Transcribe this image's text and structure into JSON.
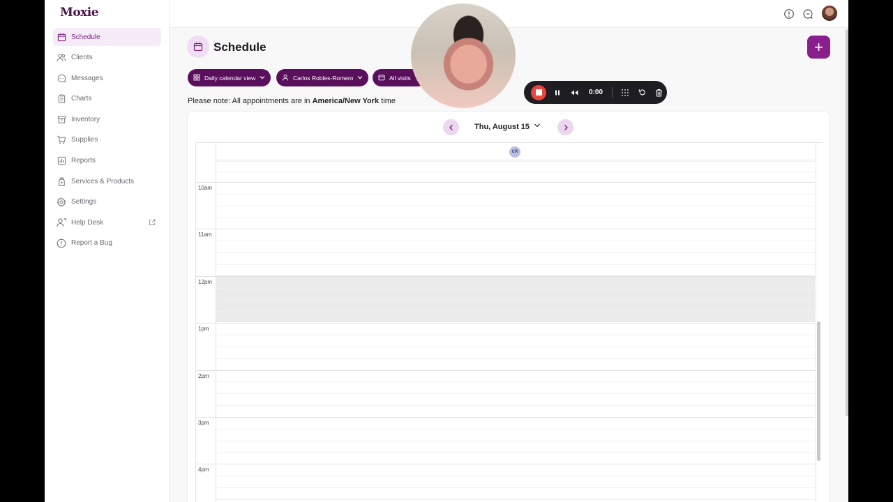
{
  "brand": {
    "logo_text": "Moxie",
    "accent": "#8a1e8c",
    "accent_dark": "#5a0f5d"
  },
  "sidebar": {
    "items": [
      {
        "label": "Schedule",
        "icon": "calendar-icon",
        "active": true
      },
      {
        "label": "Clients",
        "icon": "users-icon"
      },
      {
        "label": "Messages",
        "icon": "chat-icon"
      },
      {
        "label": "Charts",
        "icon": "clipboard-icon"
      },
      {
        "label": "Inventory",
        "icon": "archive-icon"
      },
      {
        "label": "Supplies",
        "icon": "cart-icon"
      },
      {
        "label": "Reports",
        "icon": "bar-chart-icon"
      },
      {
        "label": "Services & Products",
        "icon": "bottle-icon"
      },
      {
        "label": "Settings",
        "icon": "gear-icon"
      },
      {
        "label": "Help Desk",
        "icon": "help-person-icon",
        "external": true
      },
      {
        "label": "Report a Bug",
        "icon": "alert-circle-icon"
      }
    ]
  },
  "topbar": {
    "icons": [
      "info-icon",
      "chat-bubble-icon",
      "user-avatar"
    ]
  },
  "page": {
    "title": "Schedule",
    "add_label": "+"
  },
  "filters": {
    "view": "Daily calendar view",
    "provider": "Carlos Robles-Romero",
    "visits": "All visits"
  },
  "timezone_note": {
    "prefix": "Please note: All appointments are in ",
    "zone": "America/New York",
    "suffix": " time"
  },
  "calendar": {
    "date_label": "Thu, August 15",
    "provider_initials": "CR",
    "hours": [
      "10am",
      "11am",
      "12pm",
      "1pm",
      "2pm",
      "3pm",
      "4pm"
    ],
    "blocked_hour": "12pm"
  },
  "recorder": {
    "time": "0:00",
    "stop_color": "#e8453b"
  }
}
